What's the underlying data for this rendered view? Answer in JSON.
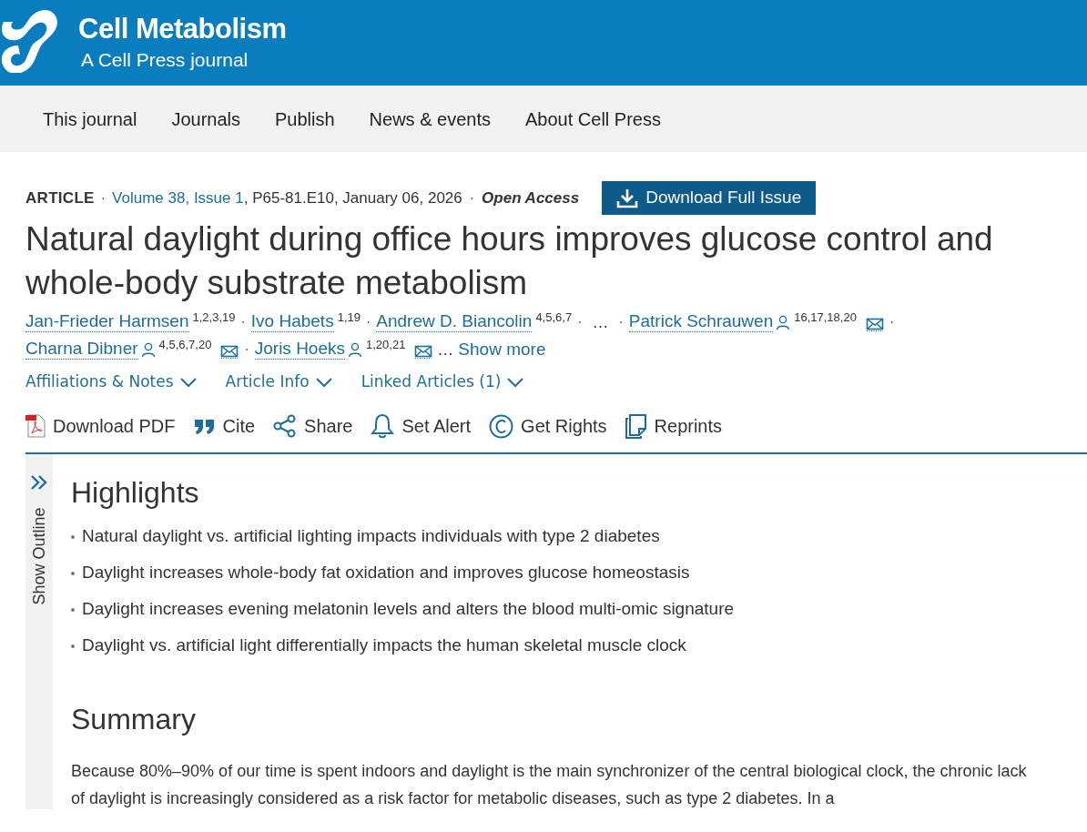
{
  "header": {
    "title": "Cell Metabolism",
    "subtitle": "A Cell Press journal"
  },
  "nav": [
    "This journal",
    "Journals",
    "Publish",
    "News & events",
    "About Cell Press"
  ],
  "meta": {
    "type": "ARTICLE",
    "sep1": "·",
    "issue": "Volume 38, Issue 1",
    "details": ", P65-81.E10, January 06, 2026",
    "sep2": "·",
    "access": "Open Access",
    "download_button": "Download Full Issue"
  },
  "title": "Natural daylight during office hours improves glucose control and whole-body substrate metabolism",
  "author_lines": [
    [
      {
        "kind": "author",
        "name": "Jan-Frieder Harmsen",
        "affiliations": "1,2,3,19",
        "profile": false,
        "email": false
      },
      {
        "kind": "sep",
        "text": "·"
      },
      {
        "kind": "author",
        "name": "Ivo Habets",
        "affiliations": "1,19",
        "profile": false,
        "email": false
      },
      {
        "kind": "sep",
        "text": "·"
      },
      {
        "kind": "author",
        "name": "Andrew D. Biancolin",
        "affiliations": "4,5,6,7",
        "profile": false,
        "email": false
      },
      {
        "kind": "sep",
        "text": "·"
      },
      {
        "kind": "ellipsis",
        "text": "…"
      },
      {
        "kind": "sep",
        "text": "·"
      },
      {
        "kind": "author",
        "name": "Patrick Schrauwen",
        "affiliations": "16,17,18,20",
        "profile": true,
        "email": true
      },
      {
        "kind": "sep",
        "text": "·"
      }
    ],
    [
      {
        "kind": "author",
        "name": "Charna Dibner",
        "affiliations": "4,5,6,7,20",
        "profile": true,
        "email": true
      },
      {
        "kind": "sep",
        "text": "·"
      },
      {
        "kind": "author",
        "name": "Joris Hoeks",
        "affiliations": "1,20,21",
        "profile": true,
        "email": true
      },
      {
        "kind": "ellipsis",
        "text": "…"
      },
      {
        "kind": "link",
        "text": "Show more"
      }
    ]
  ],
  "toggles": [
    {
      "label": "Affiliations & Notes",
      "expanded": false
    },
    {
      "label": "Article Info",
      "expanded": false
    },
    {
      "label": "Linked Articles (1)",
      "expanded": false
    }
  ],
  "actions": [
    {
      "kind": "pdf",
      "label": "Download PDF"
    },
    {
      "kind": "cite",
      "label": "Cite"
    },
    {
      "kind": "share",
      "label": "Share"
    },
    {
      "kind": "alert",
      "label": "Set Alert"
    },
    {
      "kind": "rights",
      "label": "Get Rights"
    },
    {
      "kind": "reprints",
      "label": "Reprints"
    }
  ],
  "outline": {
    "label": "Show Outline"
  },
  "highlights": {
    "heading": "Highlights",
    "items": [
      "Natural daylight vs. artificial lighting impacts individuals with type 2 diabetes",
      "Daylight increases whole-body fat oxidation and improves glucose homeostasis",
      "Daylight increases evening melatonin levels and alters the blood multi-omic signature",
      "Daylight vs. artificial light differentially impacts the human skeletal muscle clock"
    ]
  },
  "summary": {
    "heading": "Summary",
    "text": "Because 80%–90% of our time is spent indoors and daylight is the main synchronizer of the central biological clock, the chronic lack of daylight is increasingly considered as a risk factor for metabolic diseases, such as type 2 diabetes. In a"
  }
}
